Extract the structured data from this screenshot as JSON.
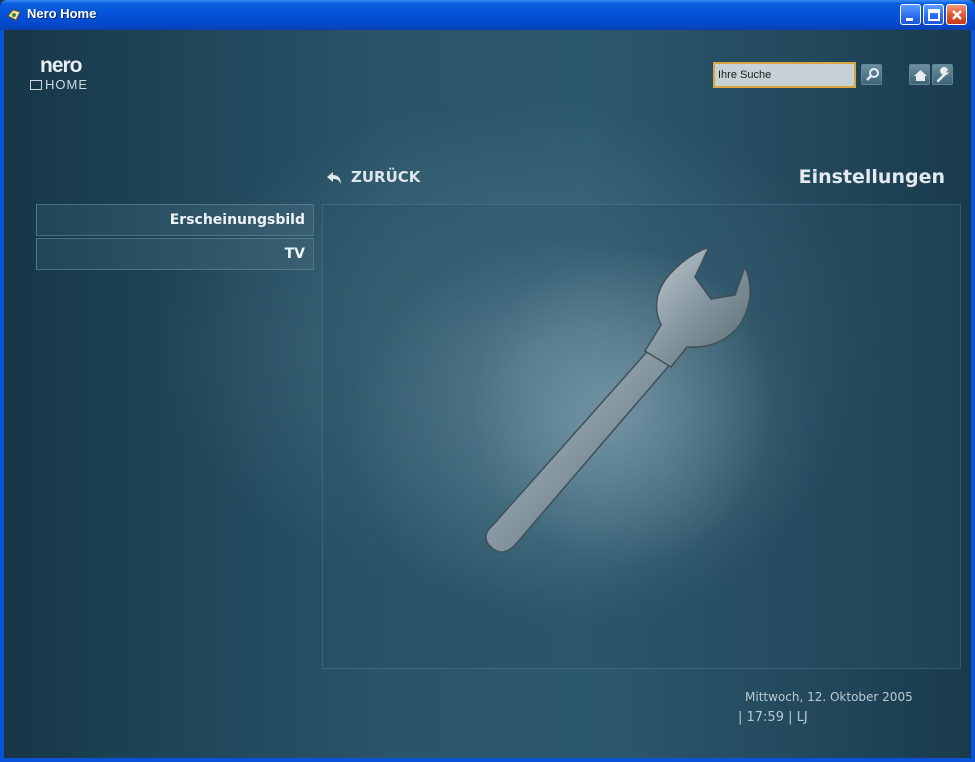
{
  "window": {
    "title": "Nero Home"
  },
  "logo": {
    "line1": "nero",
    "line2": "HOME"
  },
  "search": {
    "value": "Ihre Suche"
  },
  "nav": {
    "back_label": "ZURÜCK",
    "page_title": "Einstellungen"
  },
  "menu": {
    "items": [
      {
        "label": "Erscheinungsbild"
      },
      {
        "label": "TV"
      }
    ]
  },
  "status": {
    "date": "Mittwoch, 12. Oktober 2005",
    "time_line": "| 17:59 | LJ"
  },
  "icons": {
    "app": "nero-app-icon",
    "search": "search-icon",
    "home": "home-icon",
    "settings": "wrench-icon",
    "back": "back-arrow-icon",
    "hero": "wrench-illustration"
  },
  "colors": {
    "titlebar": "#0550d8",
    "search_border": "#d7a640",
    "text_light": "#e3eaee",
    "background": "#2a5468"
  }
}
